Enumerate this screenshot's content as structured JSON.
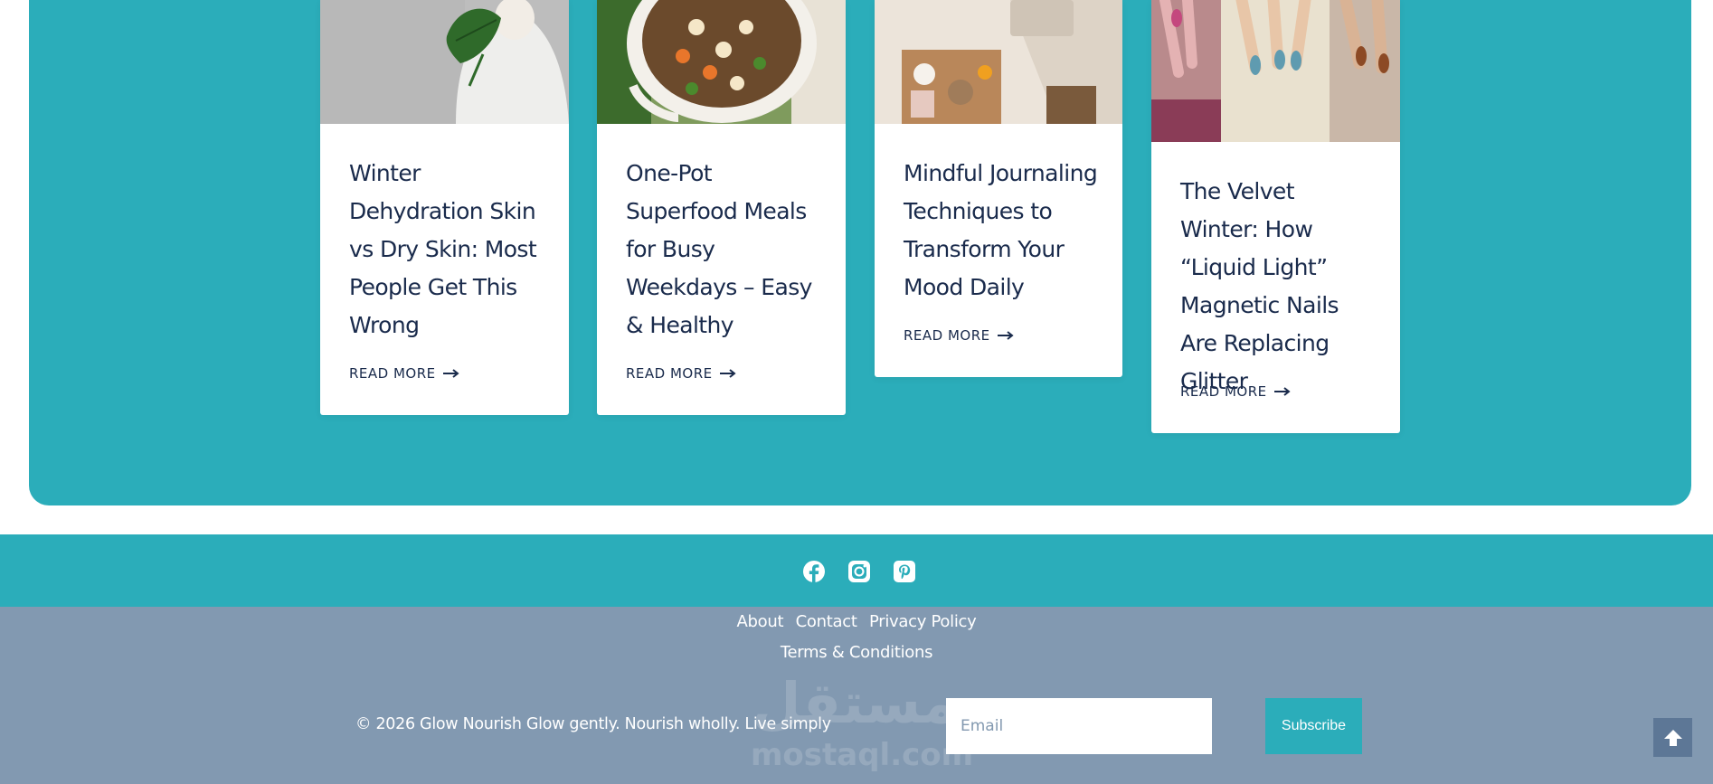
{
  "posts": [
    {
      "title": "Winter Dehydration Skin vs Dry Skin: Most People Get This Wrong",
      "read_more": "READ MORE"
    },
    {
      "title": "One-Pot Superfood Meals for Busy Weekdays – Easy & Healthy",
      "read_more": "READ MORE"
    },
    {
      "title": "Mindful Journaling Techniques to Transform Your Mood Daily",
      "read_more": "READ MORE"
    },
    {
      "title": "The Velvet Winter: How “Liquid Light” Magnetic Nails Are Replacing Glitter",
      "read_more": "READ MORE"
    }
  ],
  "social": {
    "icons": [
      "facebook-icon",
      "instagram-icon",
      "pinterest-icon"
    ]
  },
  "footer": {
    "links": [
      "About",
      "Contact",
      "Privacy Policy"
    ],
    "links_row2": [
      "Terms & Conditions"
    ],
    "copyright": "© 2026 Glow Nourish Glow gently. Nourish wholly. Live simply",
    "email_placeholder": "Email",
    "subscribe_label": "Subscribe",
    "watermark_arabic": "مستقل",
    "watermark_latin": "mostaql.com"
  },
  "colors": {
    "teal": "#2badba",
    "footer_bg": "#8299b1",
    "title_navy": "#1a2b4c",
    "scroll_button": "#5d7796"
  }
}
